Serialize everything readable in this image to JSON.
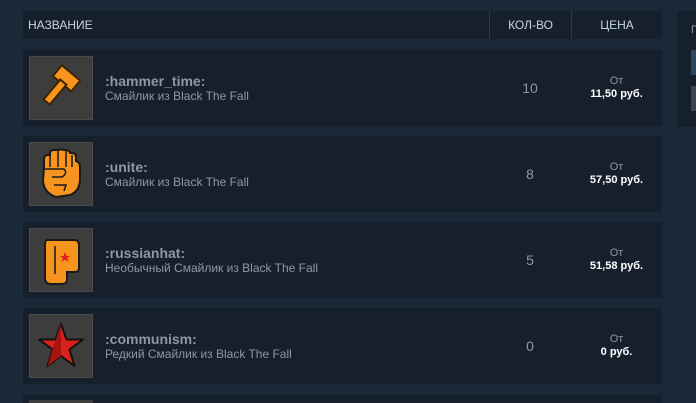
{
  "header": {
    "name": "НАЗВАНИЕ",
    "qty": "КОЛ-ВО",
    "price": "ЦЕНА"
  },
  "items": [
    {
      "name": ":hammer_time:",
      "desc": "Смайлик из Black The Fall",
      "qty": "10",
      "from": "От",
      "price": "11,50 руб.",
      "icon": "hammer-icon"
    },
    {
      "name": ":unite:",
      "desc": "Смайлик из Black The Fall",
      "qty": "8",
      "from": "От",
      "price": "57,50 руб.",
      "icon": "fist-icon"
    },
    {
      "name": ":russianhat:",
      "desc": "Необычный Смайлик из Black The Fall",
      "qty": "5",
      "from": "От",
      "price": "51,58 руб.",
      "icon": "hat-icon"
    },
    {
      "name": ":communism:",
      "desc": "Редкий Смайлик из Black The Fall",
      "qty": "0",
      "from": "От",
      "price": "0 руб.",
      "icon": "red-star-icon"
    }
  ],
  "side": {
    "label": "П"
  },
  "colors": {
    "orange": "#f7941d",
    "red": "#d9221c",
    "background": "#1b2838",
    "row": "#16202d"
  }
}
